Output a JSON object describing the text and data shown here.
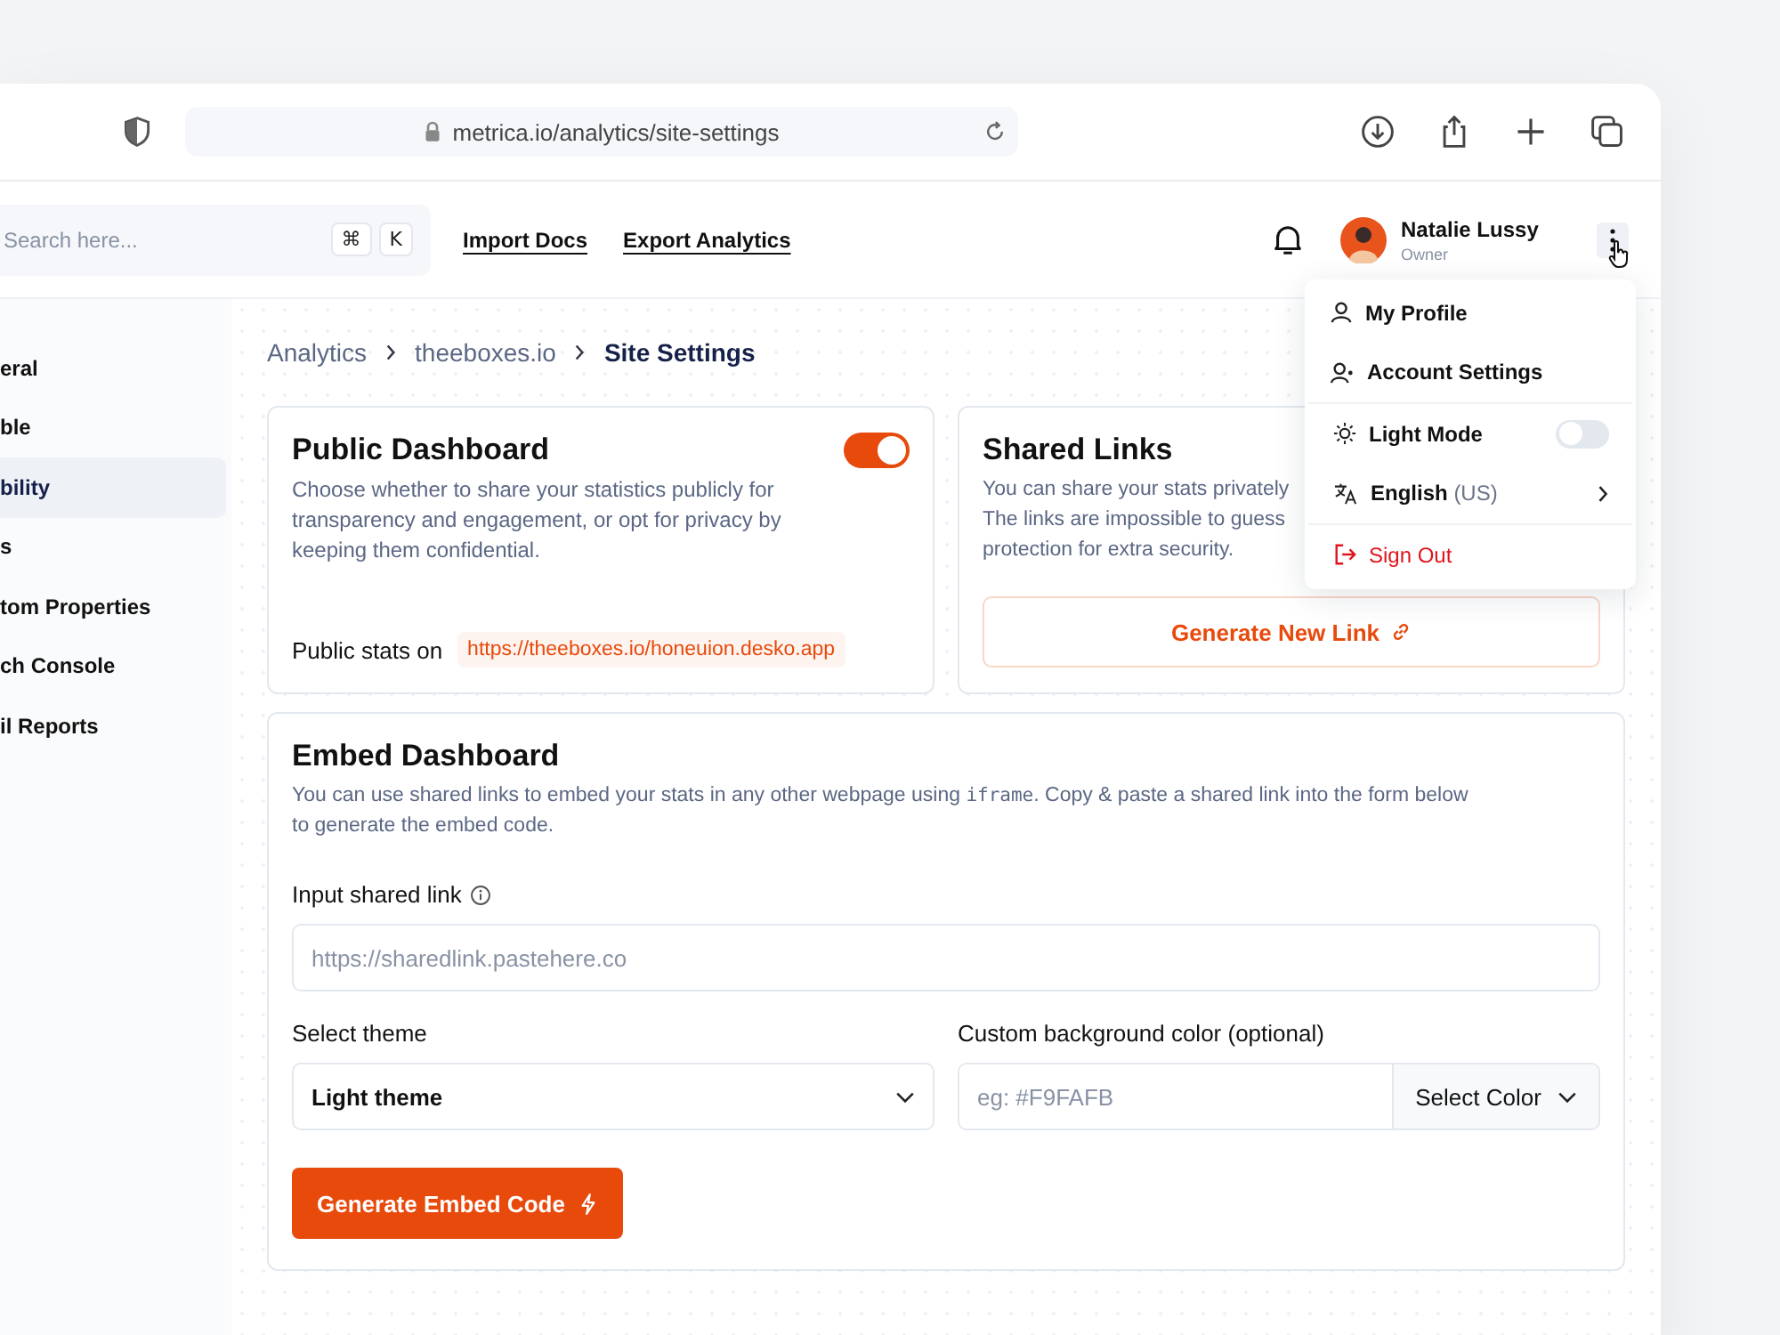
{
  "browser": {
    "url": "metrica.io/analytics/site-settings"
  },
  "header": {
    "search": {
      "placeholder": "Search here...",
      "keys": [
        "⌘",
        "K"
      ]
    },
    "links": [
      "Import Docs",
      "Export Analytics"
    ],
    "user": {
      "name": "Natalie Lussy",
      "role": "Owner"
    }
  },
  "sidebar": {
    "items": [
      {
        "label": "eral",
        "selected": false
      },
      {
        "label": "ble",
        "selected": false
      },
      {
        "label": "bility",
        "selected": true
      },
      {
        "label": "s",
        "selected": false
      },
      {
        "label": "tom Properties",
        "selected": false
      },
      {
        "label": "ch Console",
        "selected": false
      },
      {
        "label": "il Reports",
        "selected": false
      }
    ]
  },
  "breadcrumb": [
    {
      "label": "Analytics",
      "selected": false
    },
    {
      "label": "theeboxes.io",
      "selected": false
    },
    {
      "label": "Site Settings",
      "selected": true
    }
  ],
  "public_dashboard": {
    "title": "Public Dashboard",
    "on": true,
    "description": "Choose whether to share your statistics publicly for transparency and engagement, or opt for privacy by keeping them confidential.",
    "stats_label": "Public stats on",
    "stats_url": "https://theeboxes.io/honeuion.desko.app"
  },
  "shared_links": {
    "title": "Shared Links",
    "description_lines": [
      "You can share your stats privately",
      "The links are impossible to guess",
      "protection for extra security."
    ],
    "button": "Generate New Link"
  },
  "embed": {
    "title": "Embed Dashboard",
    "description_before": "You can use shared links to embed your stats in any other webpage using",
    "code": "iframe",
    "description_after": ". Copy & paste a shared link into the form below to generate the embed code.",
    "link_label": "Input shared link",
    "link_placeholder": "https://sharedlink.pastehere.co",
    "theme_label": "Select theme",
    "theme_value": "Light theme",
    "color_label": "Custom background color (optional)",
    "color_placeholder": "eg: #F9FAFB",
    "color_button": "Select Color",
    "submit": "Generate Embed Code"
  },
  "menu": {
    "groups": [
      [
        {
          "kind": "link",
          "label": "My Profile"
        },
        {
          "kind": "link",
          "label": "Account Settings"
        }
      ],
      [
        {
          "kind": "toggle",
          "label": "Light Mode",
          "on": false
        },
        {
          "kind": "submenu",
          "label": "English",
          "sub": "(US)"
        }
      ],
      [
        {
          "kind": "danger",
          "label": "Sign Out"
        }
      ]
    ]
  }
}
